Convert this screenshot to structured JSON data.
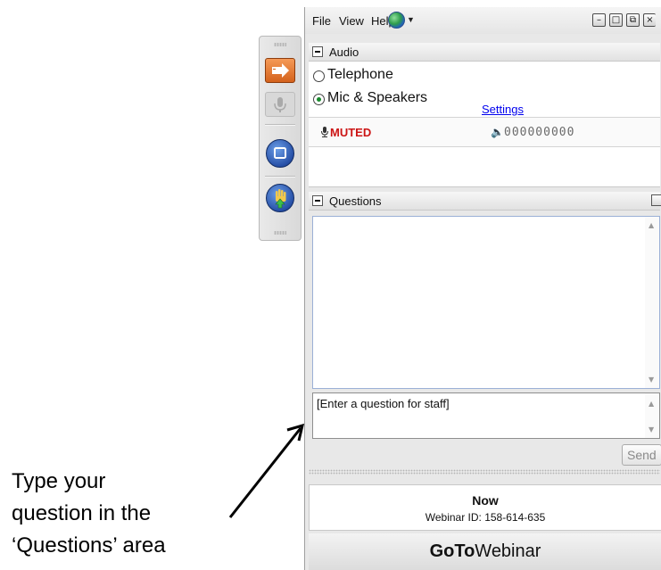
{
  "menubar": {
    "items": [
      "File",
      "View",
      "Help"
    ],
    "globe_icon": "globe-icon",
    "window_controls": [
      "minimize",
      "restore",
      "popout",
      "close"
    ]
  },
  "toolbar": {
    "buttons": [
      "show-panel-arrow-icon",
      "microphone-icon",
      "screen-icon",
      "raise-hand-icon"
    ]
  },
  "audio": {
    "title": "Audio",
    "options": [
      {
        "label": "Telephone",
        "selected": false
      },
      {
        "label": "Mic & Speakers",
        "selected": true
      }
    ],
    "settings_link": "Settings",
    "mic_status": "MUTED",
    "speaker_level": "000000000"
  },
  "questions": {
    "title": "Questions",
    "input_placeholder": "[Enter a question for staff]",
    "send_label": "Send"
  },
  "footer": {
    "status": "Now",
    "webinar_id": "Webinar ID: 158-614-635",
    "brand_bold": "GoTo",
    "brand_regular": "Webinar"
  },
  "annotation": {
    "lines": [
      "Type your",
      "question in the",
      "‘Questions’ area"
    ]
  },
  "colors": {
    "muted_red": "#cc1515",
    "link_blue": "#0000ee",
    "radio_green": "#1a8a2e",
    "toolbar_orange": "#e07a30",
    "toolbar_blue": "#2750a7"
  }
}
